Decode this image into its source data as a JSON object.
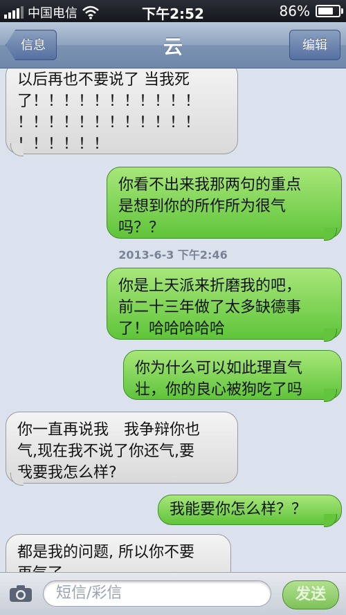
{
  "status": {
    "carrier": "中国电信",
    "time": "下午2:52",
    "battery": "86%",
    "battery_level": 0.86
  },
  "nav": {
    "back": "信息",
    "title": "云",
    "edit": "编辑"
  },
  "messages": [
    {
      "dir": "in",
      "text": "以后再也不要说了 当我死\n了！！！！！！！！！！！\n！！！！！！！！！！！！\n！！！！！！"
    },
    {
      "dir": "out",
      "text": "你看不出来我那两句的重点\n是想到你的所作所为很气\n吗？？"
    },
    {
      "dir": "time",
      "text": "2013-6-3 下午2:46"
    },
    {
      "dir": "out",
      "text": "你是上天派来折磨我的吧，\n前二十三年做了太多缺德事\n了！哈哈哈哈哈"
    },
    {
      "dir": "out",
      "text": "你为什么可以如此理直气\n壮，你的良心被狗吃了吗"
    },
    {
      "dir": "in",
      "text": "你一直再说我　我争辩你也\n气,现在我不说了你还气,要\n我要我怎么样?"
    },
    {
      "dir": "out",
      "text": "我能要你怎么样？？"
    },
    {
      "dir": "in",
      "text": "都是我的问题, 所以你不要\n再气了"
    }
  ],
  "input": {
    "placeholder": "短信/彩信",
    "send": "发送"
  },
  "icons": {
    "camera": "camera-icon",
    "wifi": "wifi-icon",
    "signal": "signal-icon",
    "battery": "battery-icon"
  },
  "colors": {
    "incoming": "#e4e4e4",
    "outgoing": "#7fd454",
    "background": "#dbe2ed"
  }
}
